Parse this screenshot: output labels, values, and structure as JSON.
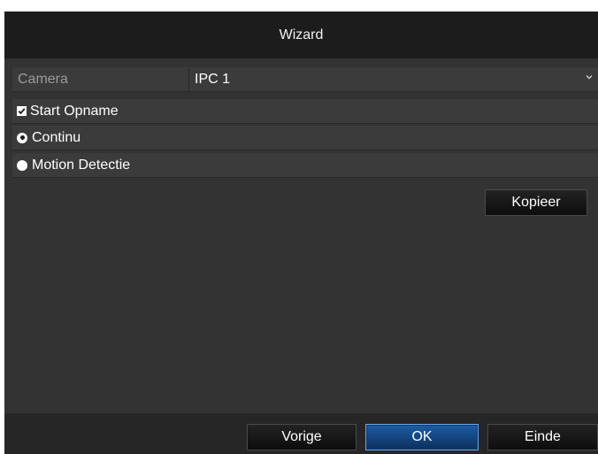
{
  "window": {
    "title": "Wizard"
  },
  "camera": {
    "label": "Camera",
    "value": "IPC 1",
    "dropdown_icon": "chevron-down-icon"
  },
  "start_opname": {
    "label": "Start Opname",
    "checked": true
  },
  "record_mode": {
    "options": [
      {
        "label": "Continu",
        "selected": true
      },
      {
        "label": "Motion Detectie",
        "selected": false
      }
    ]
  },
  "buttons": {
    "kopieer": "Kopieer",
    "vorige": "Vorige",
    "ok": "OK",
    "einde": "Einde"
  },
  "colors": {
    "background": "#333333",
    "titlebar": "#1c1c1c",
    "accent": "#1d5ea6"
  }
}
